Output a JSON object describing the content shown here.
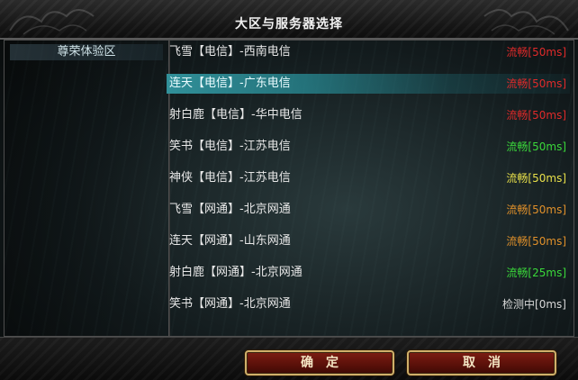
{
  "window": {
    "title": "大区与服务器选择"
  },
  "regions": [
    {
      "label": "尊荣体验区"
    }
  ],
  "servers": [
    {
      "name": "飞雪【电信】-西南电信",
      "status": "流畅[50ms]",
      "status_color": "#e02a2a",
      "selected": false
    },
    {
      "name": "连天【电信】-广东电信",
      "status": "流畅[50ms]",
      "status_color": "#e02a2a",
      "selected": true
    },
    {
      "name": "射白鹿【电信】-华中电信",
      "status": "流畅[50ms]",
      "status_color": "#e02a2a",
      "selected": false
    },
    {
      "name": "笑书【电信】-江苏电信",
      "status": "流畅[50ms]",
      "status_color": "#3ad83a",
      "selected": false
    },
    {
      "name": "神侠【电信】-江苏电信",
      "status": "流畅[50ms]",
      "status_color": "#e8e04a",
      "selected": false
    },
    {
      "name": "飞雪【网通】-北京网通",
      "status": "流畅[50ms]",
      "status_color": "#e0902a",
      "selected": false
    },
    {
      "name": "连天【网通】-山东网通",
      "status": "流畅[50ms]",
      "status_color": "#e0902a",
      "selected": false
    },
    {
      "name": "射白鹿【网通】-北京网通",
      "status": "流畅[25ms]",
      "status_color": "#3ad83a",
      "selected": false
    },
    {
      "name": "笑书【网通】-北京网通",
      "status": "检测中[0ms]",
      "status_color": "#d8d8d8",
      "selected": false
    }
  ],
  "buttons": {
    "confirm_label": "确定",
    "cancel_label": "取消"
  }
}
